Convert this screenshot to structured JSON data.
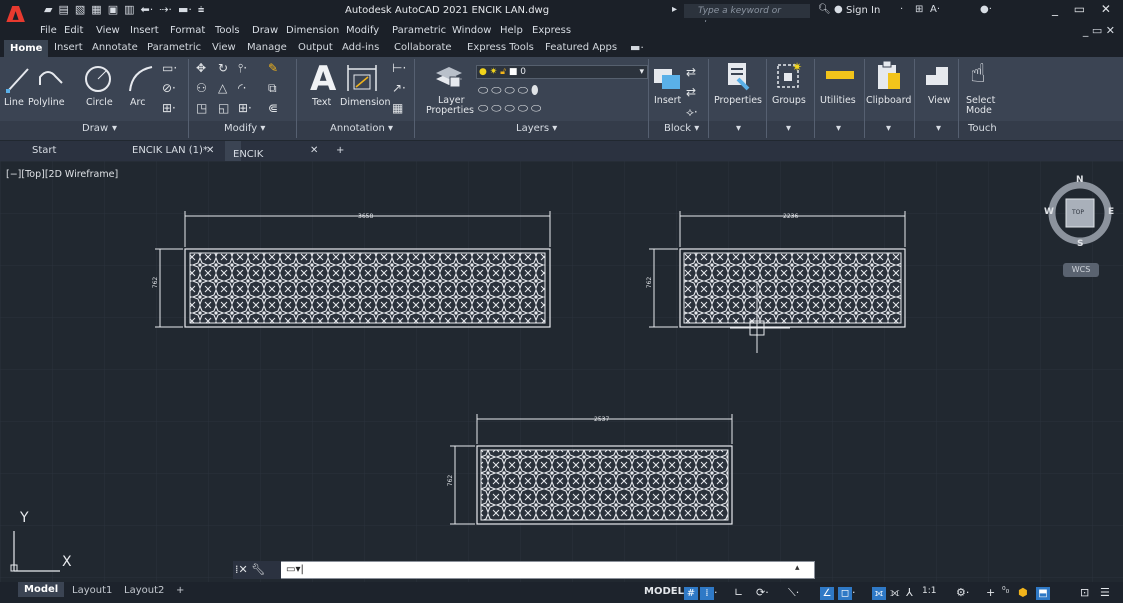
{
  "window": {
    "title": "Autodesk AutoCAD 2021   ENCIK LAN.dwg",
    "search_placeholder": "Type a keyword or phrase",
    "signin": "Sign In",
    "logo_letter": "A"
  },
  "menubar": [
    "File",
    "Edit",
    "View",
    "Insert",
    "Format",
    "Tools",
    "Draw",
    "Dimension",
    "Modify",
    "Parametric",
    "Window",
    "Help",
    "Express"
  ],
  "ribbon_tabs": [
    "Home",
    "Insert",
    "Annotate",
    "Parametric",
    "View",
    "Manage",
    "Output",
    "Add-ins",
    "Collaborate",
    "Express Tools",
    "Featured Apps"
  ],
  "ribbon": {
    "draw": {
      "title": "Draw",
      "tools": [
        "Line",
        "Polyline",
        "Circle",
        "Arc"
      ]
    },
    "modify": {
      "title": "Modify"
    },
    "annotation": {
      "title": "Annotation",
      "text": "Text",
      "dimension": "Dimension"
    },
    "layers": {
      "title": "Layers",
      "layer_props_1": "Layer",
      "layer_props_2": "Properties",
      "current_layer": "0"
    },
    "block": {
      "title": "Block",
      "insert": "Insert"
    },
    "properties": "Properties",
    "groups": "Groups",
    "utilities": "Utilities",
    "clipboard": "Clipboard",
    "view": "View",
    "select_mode_1": "Select",
    "select_mode_2": "Mode",
    "touch": "Touch"
  },
  "doc_tabs": {
    "start": "Start",
    "tab1": "ENCIK LAN (1)*",
    "tab2": "ENCIK LAN*"
  },
  "canvas": {
    "viewport_label": "[−][Top][2D Wireframe]",
    "ucs_y": "Y",
    "ucs_x": "X",
    "viewcube": {
      "n": "N",
      "s": "S",
      "e": "E",
      "w": "W",
      "top": "TOP"
    },
    "wcs": "WCS",
    "panels": [
      {
        "dim_top": "3658",
        "dim_side": "762"
      },
      {
        "dim_top": "2236",
        "dim_side": "762"
      },
      {
        "dim_top": "2537",
        "dim_side": "762"
      }
    ]
  },
  "status": {
    "layout_tabs": [
      "Model",
      "Layout1",
      "Layout2"
    ],
    "model": "MODEL",
    "scale": "1:1"
  }
}
